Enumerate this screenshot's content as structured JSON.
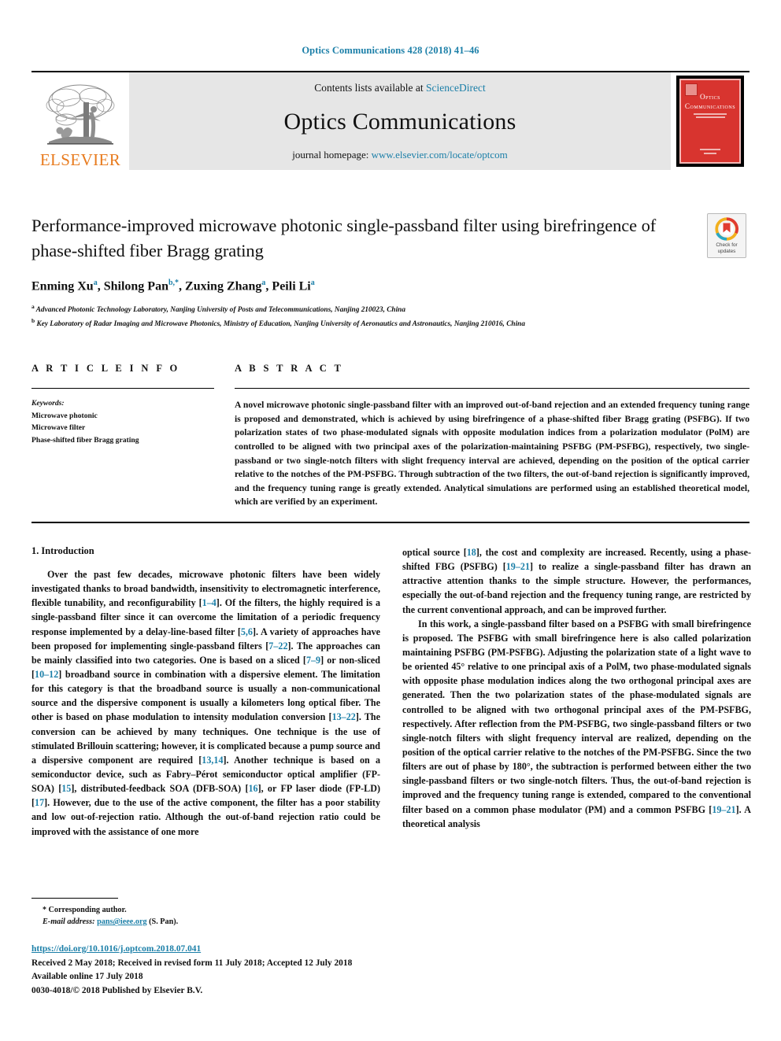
{
  "running_head": "Optics Communications 428 (2018) 41–46",
  "masthead": {
    "elsevier_wordmark": "ELSEVIER",
    "contents_prefix": "Contents lists available at ",
    "contents_link": "ScienceDirect",
    "journal_name": "Optics Communications",
    "homepage_prefix": "journal homepage: ",
    "homepage_link": "www.elsevier.com/locate/optcom",
    "cover_title": "Optics Communications"
  },
  "article": {
    "title": "Performance-improved microwave photonic single-passband filter using birefringence of phase-shifted fiber Bragg grating",
    "authors_html": "Enming Xu a, Shilong Pan b,*, Zuxing Zhang a, Peili Li a",
    "authors": [
      {
        "name": "Enming Xu",
        "marks": "a"
      },
      {
        "name": "Shilong Pan",
        "marks": "b,*"
      },
      {
        "name": "Zuxing Zhang",
        "marks": "a"
      },
      {
        "name": "Peili Li",
        "marks": "a"
      }
    ],
    "affiliations": [
      {
        "mark": "a",
        "text": "Advanced Photonic Technology Laboratory, Nanjing University of Posts and Telecommunications, Nanjing 210023, China"
      },
      {
        "mark": "b",
        "text": "Key Laboratory of Radar Imaging and Microwave Photonics, Ministry of Education, Nanjing University of Aeronautics and Astronautics, Nanjing 210016, China"
      }
    ],
    "crossmark_label": "Check for updates"
  },
  "article_info": {
    "heading": "A R T I C L E   I N F O",
    "keywords_label": "Keywords:",
    "keywords": [
      "Microwave photonic",
      "Microwave filter",
      "Phase-shifted fiber Bragg grating"
    ]
  },
  "abstract": {
    "heading": "A B S T R A C T",
    "text": "A novel microwave photonic single-passband filter with an improved out-of-band rejection and an extended frequency tuning range is proposed and demonstrated, which is achieved by using birefringence of a phase-shifted fiber Bragg grating (PSFBG). If two polarization states of two phase-modulated signals with opposite modulation indices from a polarization modulator (PolM) are controlled to be aligned with two principal axes of the polarization-maintaining PSFBG (PM-PSFBG), respectively, two single-passband or two single-notch filters with slight frequency interval are achieved, depending on the position of the optical carrier relative to the notches of the PM-PSFBG. Through subtraction of the two filters, the out-of-band rejection is significantly improved, and the frequency tuning range is greatly extended. Analytical simulations are performed using an established theoretical model, which are verified by an experiment."
  },
  "introduction": {
    "section_title": "1.  Introduction",
    "left_paragraphs": [
      "Over the past few decades, microwave photonic filters have been widely investigated thanks to broad bandwidth, insensitivity to electromagnetic interference, flexible tunability, and reconfigurability [1–4]. Of the filters, the highly required is a single-passband filter since it can overcome the limitation of a periodic frequency response implemented by a delay-line-based filter [5,6]. A variety of approaches have been proposed for implementing single-passband filters [7–22]. The approaches can be mainly classified into two categories. One is based on a sliced [7–9] or non-sliced [10–12] broadband source in combination with a dispersive element. The limitation for this category is that the broadband source is usually a non-communicational source and the dispersive component is usually a kilometers long optical fiber. The other is based on phase modulation to intensity modulation conversion [13–22]. The conversion can be achieved by many techniques. One technique is the use of stimulated Brillouin scattering; however, it is complicated because a pump source and a dispersive component are required [13,14]. Another technique is based on a semiconductor device, such as Fabry–Pérot semiconductor optical amplifier (FP-SOA) [15], distributed-feedback SOA (DFB-SOA) [16], or FP laser diode (FP-LD) [17]. However, due to the use of the active component, the filter has a poor stability and low out-of-rejection ratio. Although the out-of-band rejection ratio could be improved with the assistance of one more"
    ],
    "right_paragraphs": [
      "optical source [18], the cost and complexity are increased. Recently, using a phase-shifted FBG (PSFBG) [19–21] to realize a single-passband filter has drawn an attractive attention thanks to the simple structure. However, the performances, especially the out-of-band rejection and the frequency tuning range, are restricted by the current conventional approach, and can be improved further.",
      "In this work, a single-passband filter based on a PSFBG with small birefringence is proposed. The PSFBG with small birefringence here is also called polarization maintaining PSFBG (PM-PSFBG). Adjusting the polarization state of a light wave to be oriented 45° relative to one principal axis of a PolM, two phase-modulated signals with opposite phase modulation indices along the two orthogonal principal axes are generated. Then the two polarization states of the phase-modulated signals are controlled to be aligned with two orthogonal principal axes of the PM-PSFBG, respectively. After reflection from the PM-PSFBG, two single-passband filters or two single-notch filters with slight frequency interval are realized, depending on the position of the optical carrier relative to the notches of the PM-PSFBG. Since the two filters are out of phase by 180°, the subtraction is performed between either the two single-passband filters or two single-notch filters. Thus, the out-of-band rejection is improved and the frequency tuning range is extended, compared to the conventional filter based on a common phase modulator (PM) and a common PSFBG [19–21]. A theoretical analysis"
    ]
  },
  "footnote": {
    "star": "*",
    "corresponding": "Corresponding author.",
    "email_label": "E-mail address:",
    "email": "pans@ieee.org",
    "email_owner": "(S. Pan)."
  },
  "footer": {
    "doi": "https://doi.org/10.1016/j.optcom.2018.07.041",
    "history": "Received 2 May 2018; Received in revised form 11 July 2018; Accepted 12 July 2018",
    "available": "Available online 17 July 2018",
    "copyright": "0030-4018/© 2018 Published by Elsevier B.V."
  },
  "colors": {
    "link": "#1b7fa8",
    "elsevier_orange": "#e87b1e",
    "cover_red": "#d8342f",
    "band_gray": "#e6e6e6"
  }
}
